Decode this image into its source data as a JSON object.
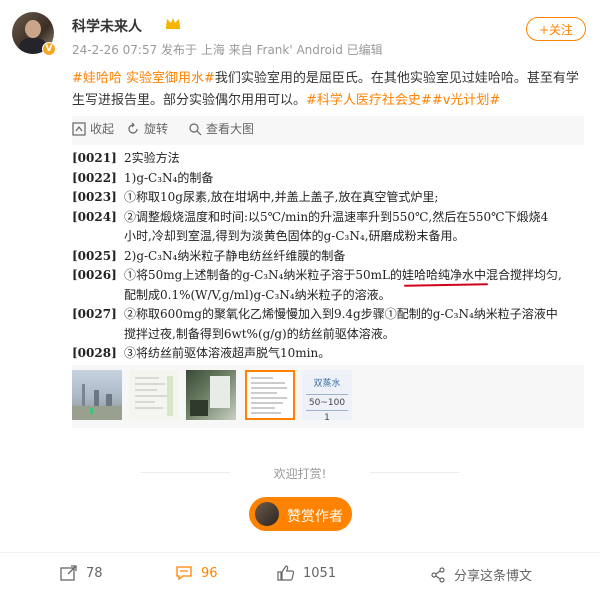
{
  "post": {
    "username": "科学未来人",
    "meta": "24-2-26 07:57  发布于 上海  来自 Frank' Android  已编辑",
    "follow_label": "+关注",
    "text_tag1": "#娃哈哈 实验室御用水#",
    "text_body": "我们实验室用的是屈臣氏。在其他实验室见过娃哈哈。甚至有学生写进报告里。部分实验偶尔用用可以。",
    "text_tag2": "#科学人医疗社会史#",
    "text_tag3": "#v光计划#"
  },
  "image_toolbar": {
    "collapse": "收起",
    "rotate": "旋转",
    "view_large": "查看大图"
  },
  "document": {
    "lines": [
      {
        "num": "[0021]",
        "text": "2实验方法"
      },
      {
        "num": "[0022]",
        "text": "1)g-C₃N₄的制备"
      },
      {
        "num": "[0023]",
        "text": "①称取10g尿素,放在坩埚中,并盖上盖子,放在真空管式炉里;"
      },
      {
        "num": "[0024]",
        "text": "②调整煅烧温度和时间:以5℃/min的升温速率升到550℃,然后在550℃下煅烧4"
      },
      {
        "num": "",
        "text": "小时,冷却到室温,得到为淡黄色固体的g-C₃N₄,研磨成粉末备用。"
      },
      {
        "num": "[0025]",
        "text": "2)g-C₃N₄纳米粒子静电纺丝纤维膜的制备"
      },
      {
        "num": "[0026]",
        "text": "①将50mg上述制备的g-C₃N₄纳米粒子溶于50mL的娃哈哈纯净水中混合搅拌均匀,"
      },
      {
        "num": "",
        "text": "配制成0.1%(W/V,g/ml)g-C₃N₄纳米粒子的溶液。"
      },
      {
        "num": "[0027]",
        "text": "②称取600mg的聚氧化乙烯慢慢加入到9.4g步骤①配制的g-C₃N₄纳米粒子溶液中"
      },
      {
        "num": "",
        "text": "搅拌过夜,制备得到6wt%(g/g)的纺丝前驱体溶液。"
      },
      {
        "num": "[0028]",
        "text": "③将纺丝前驱体溶液超声脱气10min。"
      }
    ]
  },
  "thumbnails": {
    "t5_header": "双蒸水",
    "t5_row1": "50~100",
    "t5_row2": "1"
  },
  "appreciation": {
    "title": "欢迎打赏!",
    "reward_label": "赞赏作者"
  },
  "footer": {
    "reposts": "78",
    "comments": "96",
    "likes": "1051",
    "share": "分享这条博文"
  },
  "colors": {
    "accent": "#ff8200",
    "meta": "#999999",
    "underline": "#d0021b"
  }
}
